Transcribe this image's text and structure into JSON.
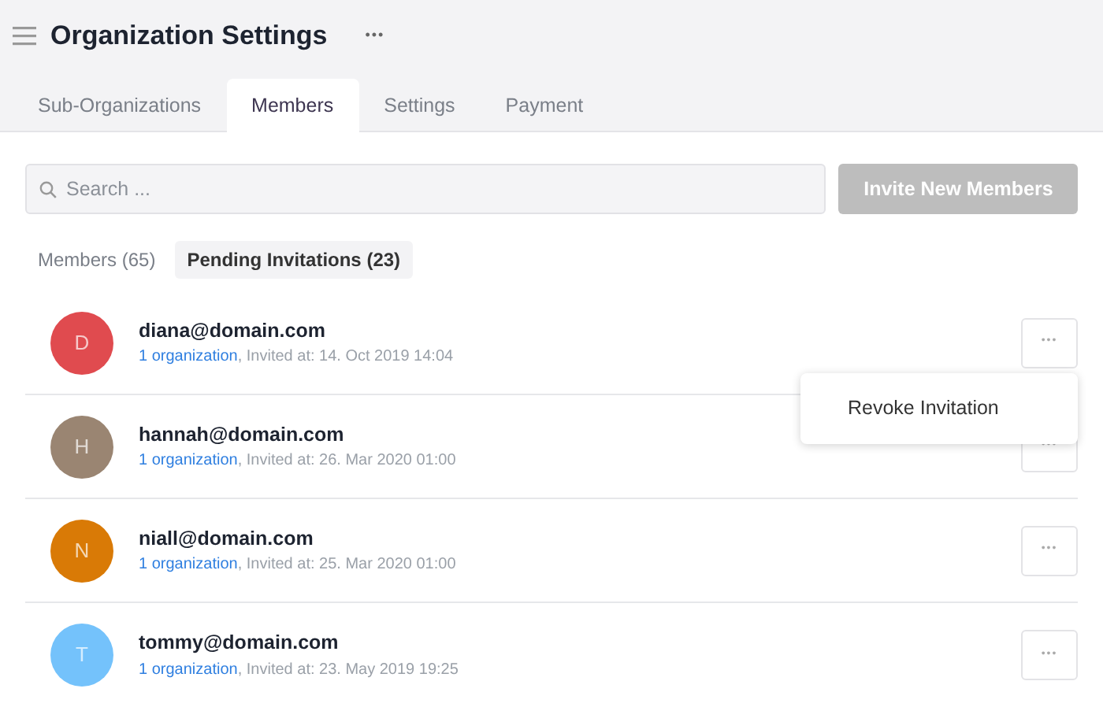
{
  "header": {
    "title": "Organization Settings",
    "more": "•••"
  },
  "tabs": [
    {
      "label": "Sub-Organizations",
      "selected": false
    },
    {
      "label": "Members",
      "selected": true
    },
    {
      "label": "Settings",
      "selected": false
    },
    {
      "label": "Payment",
      "selected": false
    }
  ],
  "search": {
    "placeholder": "Search ..."
  },
  "invite_button": {
    "label": "Invite New Members",
    "disabled": true
  },
  "subtabs": [
    {
      "label": "Members (65)",
      "selected": false
    },
    {
      "label": "Pending Invitations (23)",
      "selected": true
    }
  ],
  "invitations": [
    {
      "initial": "D",
      "color": "#e04b4f",
      "email": "diana@domain.com",
      "link": "1 organization",
      "invited": ", Invited at: 14. Oct 2019 14:04",
      "menu_open": true
    },
    {
      "initial": "H",
      "color": "#9a8572",
      "email": "hannah@domain.com",
      "link": "1 organization",
      "invited": ", Invited at: 26. Mar 2020 01:00",
      "menu_open": false
    },
    {
      "initial": "N",
      "color": "#d97a06",
      "email": "niall@domain.com",
      "link": "1 organization",
      "invited": ", Invited at: 25. Mar 2020 01:00",
      "menu_open": false
    },
    {
      "initial": "T",
      "color": "#74c2fb",
      "email": "tommy@domain.com",
      "link": "1 organization",
      "invited": ", Invited at: 23. May 2019 19:25",
      "menu_open": false
    }
  ],
  "row_menu": {
    "items": [
      "Revoke Invitation"
    ]
  },
  "row_button": "•••"
}
